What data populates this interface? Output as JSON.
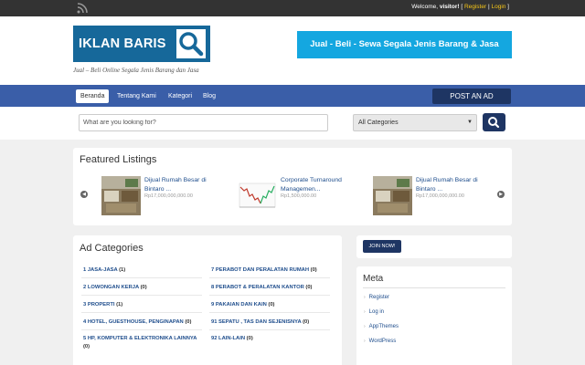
{
  "topbar": {
    "welcome_prefix": "Welcome, ",
    "username": "visitor!",
    "register_label": "Register",
    "login_label": "Login",
    "rss_icon": "rss-icon"
  },
  "header": {
    "logo_text": "IKLAN BARIS",
    "logo_icon": "magnifier-icon",
    "tagline": "Jual – Beli Online Segala Jenis Barang dan Jasa",
    "banner_text": "Jual - Beli - Sewa Segala Jenis Barang & Jasa",
    "colors": {
      "logo_blue": "#16689a",
      "banner_blue": "#14a7e0"
    }
  },
  "nav": {
    "items": [
      "Beranda",
      "Tentang Kami",
      "Kategori",
      "Blog"
    ],
    "active": "Beranda",
    "post_ad_label": "POST AN AD",
    "colors": {
      "bar": "#3a5ea8",
      "button": "#1e3563"
    }
  },
  "search": {
    "placeholder": "What are you looking for?",
    "category_selected": "All Categories",
    "button_icon": "search-icon"
  },
  "featured": {
    "title": "Featured Listings",
    "listings": [
      {
        "title": "Dijual Rumah Besar di Bintaro ...",
        "price": "Rp17,000,000,000.00"
      },
      {
        "title": "Corporate Turnaround Managemen...",
        "price": "Rp1,500,000.00"
      },
      {
        "title": "Dijual Rumah Besar di Bintaro ...",
        "price": "Rp17,000,000,000.00"
      }
    ]
  },
  "ad_categories": {
    "title": "Ad Categories",
    "left": [
      {
        "name": "1 JASA-JASA",
        "count": "(1)"
      },
      {
        "name": "2 LOWONGAN KERJA",
        "count": "(0)"
      },
      {
        "name": "3 PROPERTI",
        "count": "(1)"
      },
      {
        "name": "4 HOTEL, GUESTHOUSE, PENGINAPAN",
        "count": "(0)"
      },
      {
        "name": "5 HP, KOMPUTER & ELEKTRONIKA LAINNYA",
        "count": "(0)"
      }
    ],
    "right": [
      {
        "name": "7 PERABOT DAN PERALATAN RUMAH",
        "count": "(0)"
      },
      {
        "name": "8 PERABOT & PERALATAN KANTOR",
        "count": "(0)"
      },
      {
        "name": "9 PAKAIAN DAN KAIN",
        "count": "(0)"
      },
      {
        "name": "91 SEPATU , TAS DAN SEJENISNYA",
        "count": "(0)"
      },
      {
        "name": "92 LAIN-LAIN",
        "count": "(0)"
      }
    ]
  },
  "sidebar": {
    "join_label": "JOIN NOW!",
    "meta_title": "Meta",
    "meta_items": [
      "Register",
      "Log in",
      "AppThemes",
      "WordPress"
    ]
  }
}
